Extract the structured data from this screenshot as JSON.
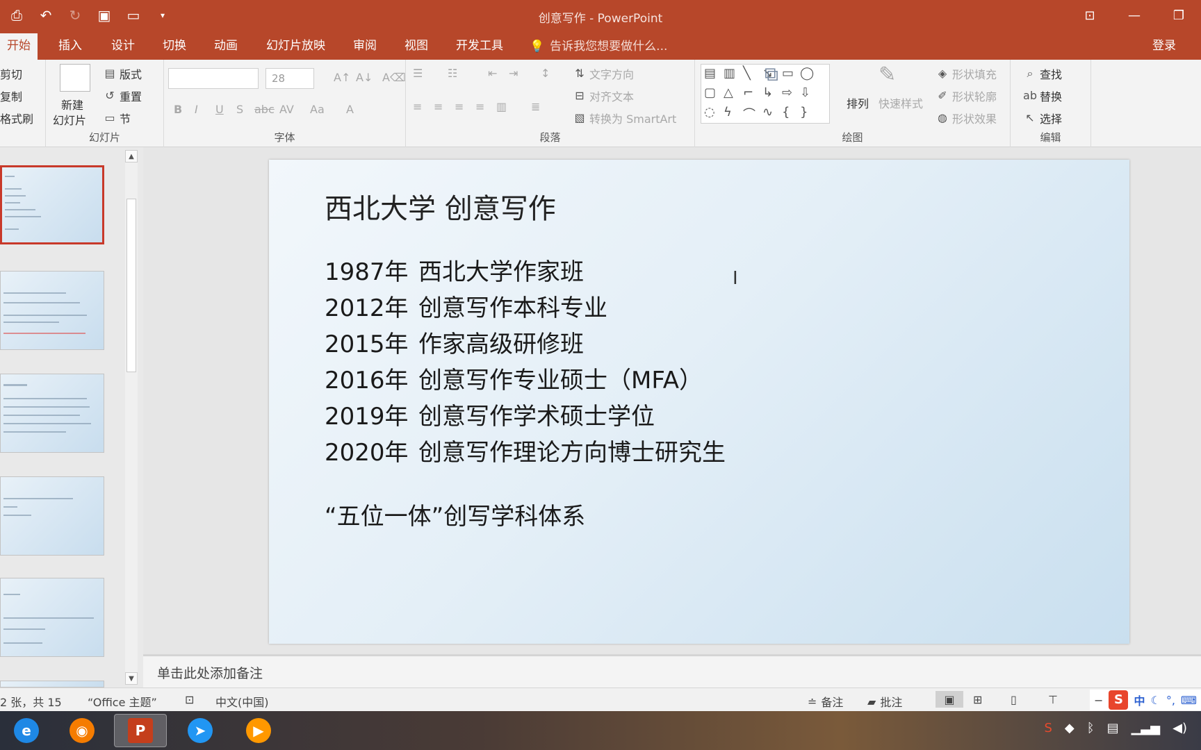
{
  "window": {
    "title": "创意写作 - PowerPoint"
  },
  "tabs": [
    "开始",
    "插入",
    "设计",
    "切换",
    "动画",
    "幻灯片放映",
    "审阅",
    "视图",
    "开发工具"
  ],
  "tell_me": "告诉我您想要做什么...",
  "login": "登录",
  "ribbon": {
    "clipboard": {
      "cut": "剪切",
      "copy": "复制",
      "format_painter": "格式刷"
    },
    "slides": {
      "new_slide_line1": "新建",
      "new_slide_line2": "幻灯片",
      "layout": "版式",
      "reset": "重置",
      "section": "节",
      "label": "幻灯片"
    },
    "font": {
      "size": "28",
      "label": "字体"
    },
    "paragraph": {
      "text_direction": "文字方向",
      "align_text": "对齐文本",
      "convert_smartart": "转换为 SmartArt",
      "label": "段落"
    },
    "drawing": {
      "arrange": "排列",
      "quick_styles": "快速样式",
      "shape_fill": "形状填充",
      "shape_outline": "形状轮廓",
      "shape_effects": "形状效果",
      "label": "绘图"
    },
    "editing": {
      "find": "查找",
      "replace": "替换",
      "select": "选择",
      "label": "编辑"
    }
  },
  "slide": {
    "title": "西北大学 创意写作",
    "entries": [
      {
        "year": "1987年",
        "text": "西北大学作家班"
      },
      {
        "year": "2012年",
        "text": "创意写作本科专业"
      },
      {
        "year": "2015年",
        "text": "作家高级研修班"
      },
      {
        "year": "2016年",
        "text": "创意写作专业硕士（MFA）"
      },
      {
        "year": "2019年",
        "text": "创意写作学术硕士学位"
      },
      {
        "year": "2020年",
        "text": "创意写作理论方向博士研究生"
      }
    ],
    "footer": "“五位一体”创写学科体系"
  },
  "notes_placeholder": "单击此处添加备注",
  "status": {
    "slide_count": "2 张，共 15",
    "theme": "“Office 主题”",
    "language": "中文(中国)",
    "notes": "备注",
    "comments": "批注"
  },
  "ime": {
    "logo": "S",
    "mode": "中"
  }
}
